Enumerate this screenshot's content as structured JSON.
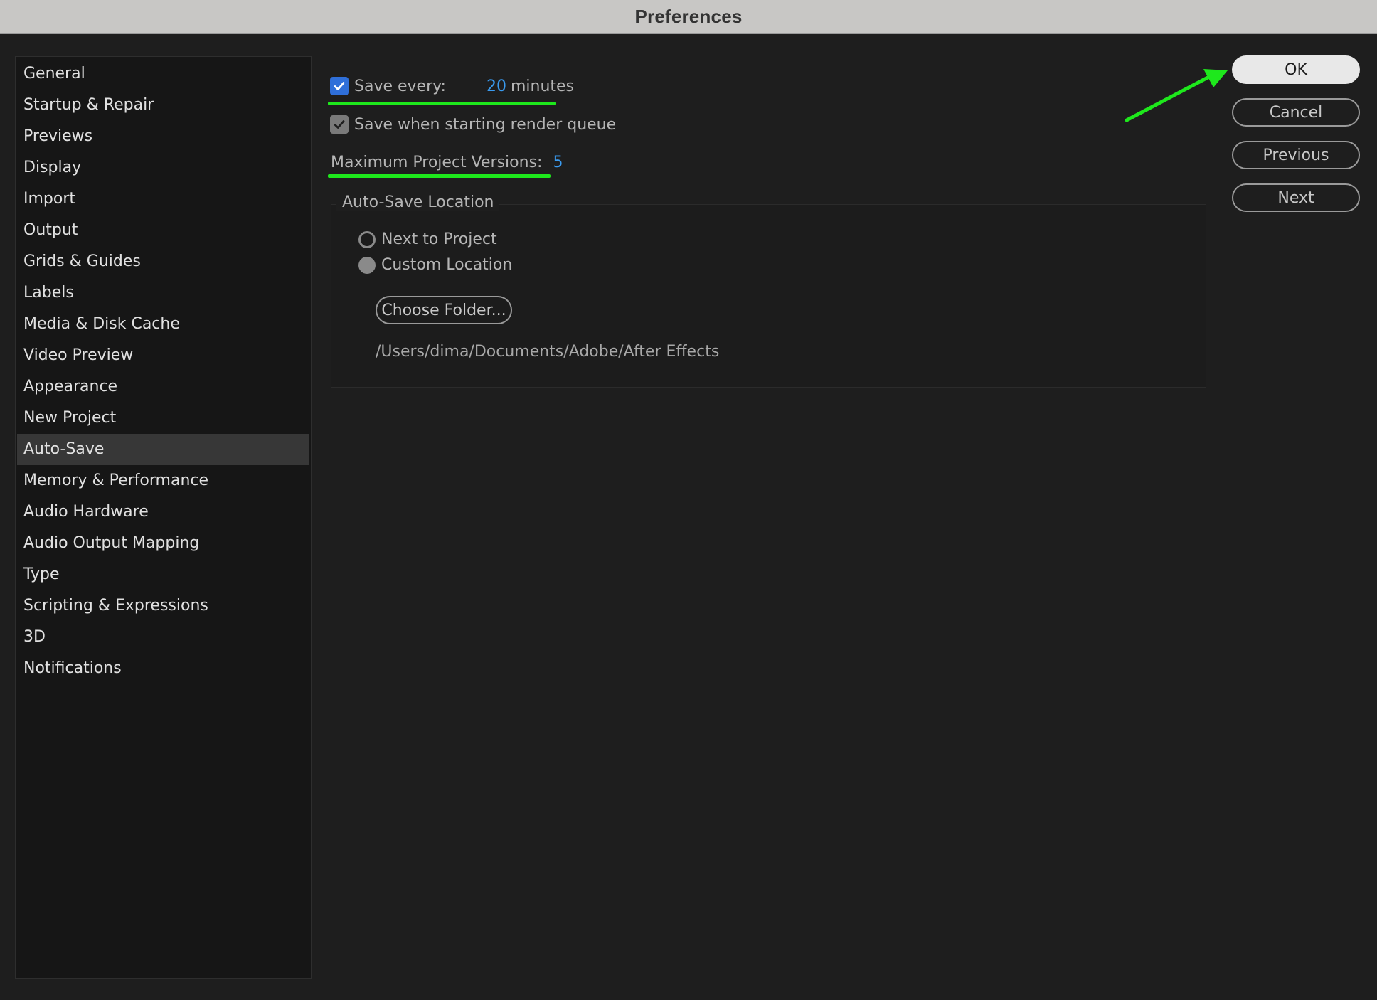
{
  "window": {
    "title": "Preferences"
  },
  "sidebar": {
    "items": [
      {
        "label": "General"
      },
      {
        "label": "Startup & Repair"
      },
      {
        "label": "Previews"
      },
      {
        "label": "Display"
      },
      {
        "label": "Import"
      },
      {
        "label": "Output"
      },
      {
        "label": "Grids & Guides"
      },
      {
        "label": "Labels"
      },
      {
        "label": "Media & Disk Cache"
      },
      {
        "label": "Video Preview"
      },
      {
        "label": "Appearance"
      },
      {
        "label": "New Project"
      },
      {
        "label": "Auto-Save",
        "selected": true
      },
      {
        "label": "Memory & Performance"
      },
      {
        "label": "Audio Hardware"
      },
      {
        "label": "Audio Output Mapping"
      },
      {
        "label": "Type"
      },
      {
        "label": "Scripting & Expressions"
      },
      {
        "label": "3D"
      },
      {
        "label": "Notifications"
      }
    ]
  },
  "autosave": {
    "save_every": {
      "label": "Save every:",
      "checked": true,
      "value": "20",
      "unit": "minutes"
    },
    "save_on_render": {
      "label": "Save when starting render queue",
      "checked": true
    },
    "max_versions": {
      "label": "Maximum Project Versions:",
      "value": "5"
    },
    "location": {
      "group_label": "Auto-Save Location",
      "option_next_to_project": "Next to Project",
      "option_custom": "Custom Location",
      "selected": "Custom Location",
      "choose_folder_label": "Choose Folder...",
      "path": "/Users/dima/Documents/Adobe/After Effects"
    }
  },
  "buttons": {
    "ok": "OK",
    "cancel": "Cancel",
    "previous": "Previous",
    "next": "Next"
  },
  "colors": {
    "accent_blue": "#2f6fd9",
    "value_blue": "#3a9bf0",
    "annotation_green": "#1ee81c"
  }
}
